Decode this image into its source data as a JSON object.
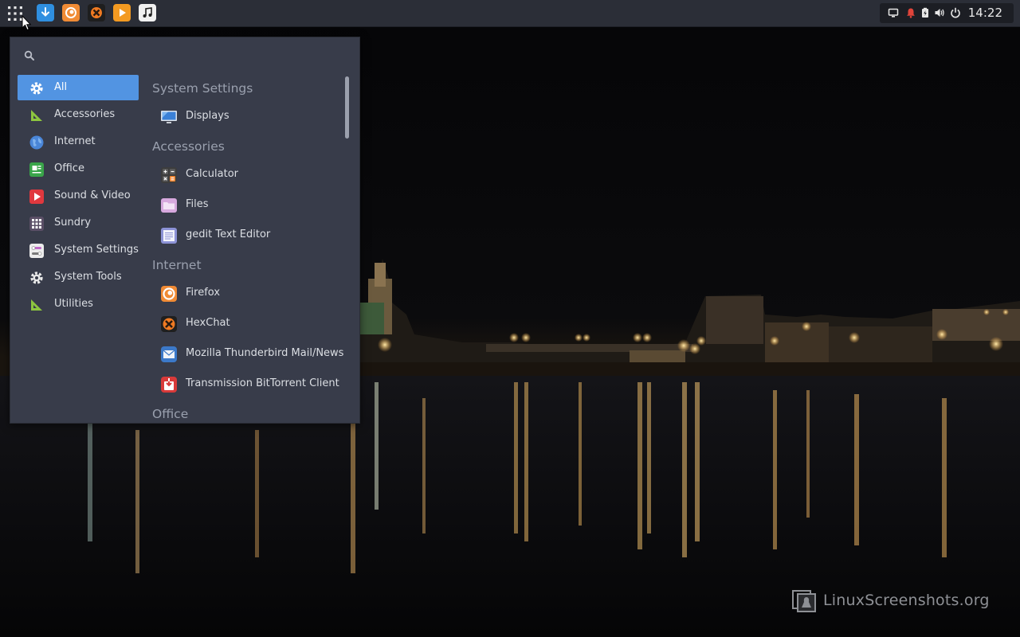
{
  "panel": {
    "launchers": [
      {
        "icon": "download-manager-icon",
        "color": "#2f8fe0"
      },
      {
        "icon": "firefox-icon",
        "color": "#f08b35"
      },
      {
        "icon": "hexchat-icon",
        "color": "#f07a22"
      },
      {
        "icon": "media-player-icon",
        "color": "#f39a21"
      },
      {
        "icon": "music-icon",
        "color": "#f1f1f1"
      }
    ],
    "tray_icons": [
      "display-icon",
      "notification-bell-icon",
      "battery-icon",
      "volume-icon",
      "power-icon"
    ],
    "clock": "14:22"
  },
  "menu": {
    "search": {
      "placeholder": "",
      "value": ""
    },
    "categories": [
      {
        "label": "All",
        "icon": "gear-icon",
        "selected": true
      },
      {
        "label": "Accessories",
        "icon": "ruler-icon"
      },
      {
        "label": "Internet",
        "icon": "globe-icon"
      },
      {
        "label": "Office",
        "icon": "office-icon"
      },
      {
        "label": "Sound & Video",
        "icon": "play-icon"
      },
      {
        "label": "Sundry",
        "icon": "grid-icon"
      },
      {
        "label": "System Settings",
        "icon": "toggle-settings-icon"
      },
      {
        "label": "System Tools",
        "icon": "gear-icon"
      },
      {
        "label": "Utilities",
        "icon": "ruler-icon"
      }
    ],
    "sections": [
      {
        "title": "System Settings",
        "apps": [
          {
            "label": "Displays",
            "icon": "monitor-icon"
          }
        ]
      },
      {
        "title": "Accessories",
        "apps": [
          {
            "label": "Calculator",
            "icon": "calculator-icon"
          },
          {
            "label": "Files",
            "icon": "folder-icon"
          },
          {
            "label": "gedit Text Editor",
            "icon": "text-editor-icon"
          }
        ]
      },
      {
        "title": "Internet",
        "apps": [
          {
            "label": "Firefox",
            "icon": "firefox-icon"
          },
          {
            "label": "HexChat",
            "icon": "hexchat-icon"
          },
          {
            "label": "Mozilla Thunderbird Mail/News",
            "icon": "mail-icon"
          },
          {
            "label": "Transmission BitTorrent Client",
            "icon": "transmission-icon"
          }
        ]
      },
      {
        "title": "Office",
        "apps": []
      }
    ]
  },
  "watermark": {
    "text": "LinuxScreenshots.org",
    "icon": "penguin-logo-icon"
  },
  "colors": {
    "panel": "#2b2e37",
    "menu": "#383c4a",
    "accent": "#5294e2",
    "section_header": "#9aa0ae"
  }
}
